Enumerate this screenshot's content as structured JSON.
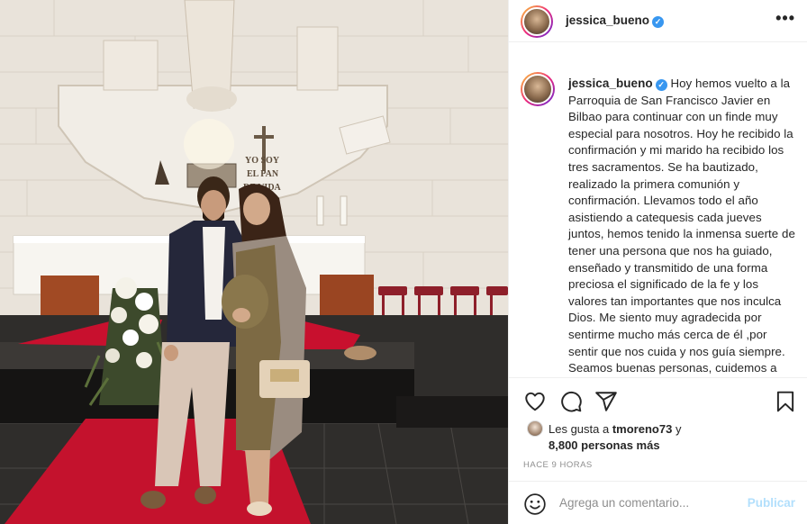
{
  "post": {
    "username": "jessica_bueno",
    "verified_symbol": "✓",
    "caption": "Hoy hemos vuelto a la Parroquia de San Francisco Javier en Bilbao para continuar con un finde muy especial para nosotros. Hoy he recibido la confirmación y mi marido ha recibido los tres sacramentos. Se ha bautizado, realizado la primera comunión y confirmación. Llevamos todo el año asistiendo a catequesis cada jueves juntos, hemos tenido la inmensa suerte de tener una persona que nos ha guiado, enseñado y transmitido de una forma preciosa el significado de la fe y los valores tan importantes que nos inculca Dios. Me siento muy agradecida por sentirme mucho más cerca de él ,por sentir que nos cuida y nos guía siempre. Seamos buenas personas, cuidemos a los que",
    "likes_prefix": "Les gusta a",
    "likes_user": "tmoreno73",
    "likes_conjunction": "y",
    "likes_others": "8,800 personas más",
    "time_ago": "HACE 9 HORAS",
    "more_menu": "•••"
  },
  "photo": {
    "altar_text_line1": "YO SOY",
    "altar_text_line2": "EL PAN",
    "altar_text_line3": "DE VIDA"
  },
  "comment": {
    "placeholder": "Agrega un comentario...",
    "publish_label": "Publicar"
  },
  "icons": [
    "heart-icon",
    "comment-icon",
    "share-icon",
    "bookmark-icon",
    "emoji-icon",
    "more-icon",
    "verified-icon"
  ],
  "colors": {
    "verified": "#3897f0",
    "publish_disabled": "#b2dffc",
    "secondary_text": "#8e8e8e",
    "carpet": "#c8102e"
  }
}
